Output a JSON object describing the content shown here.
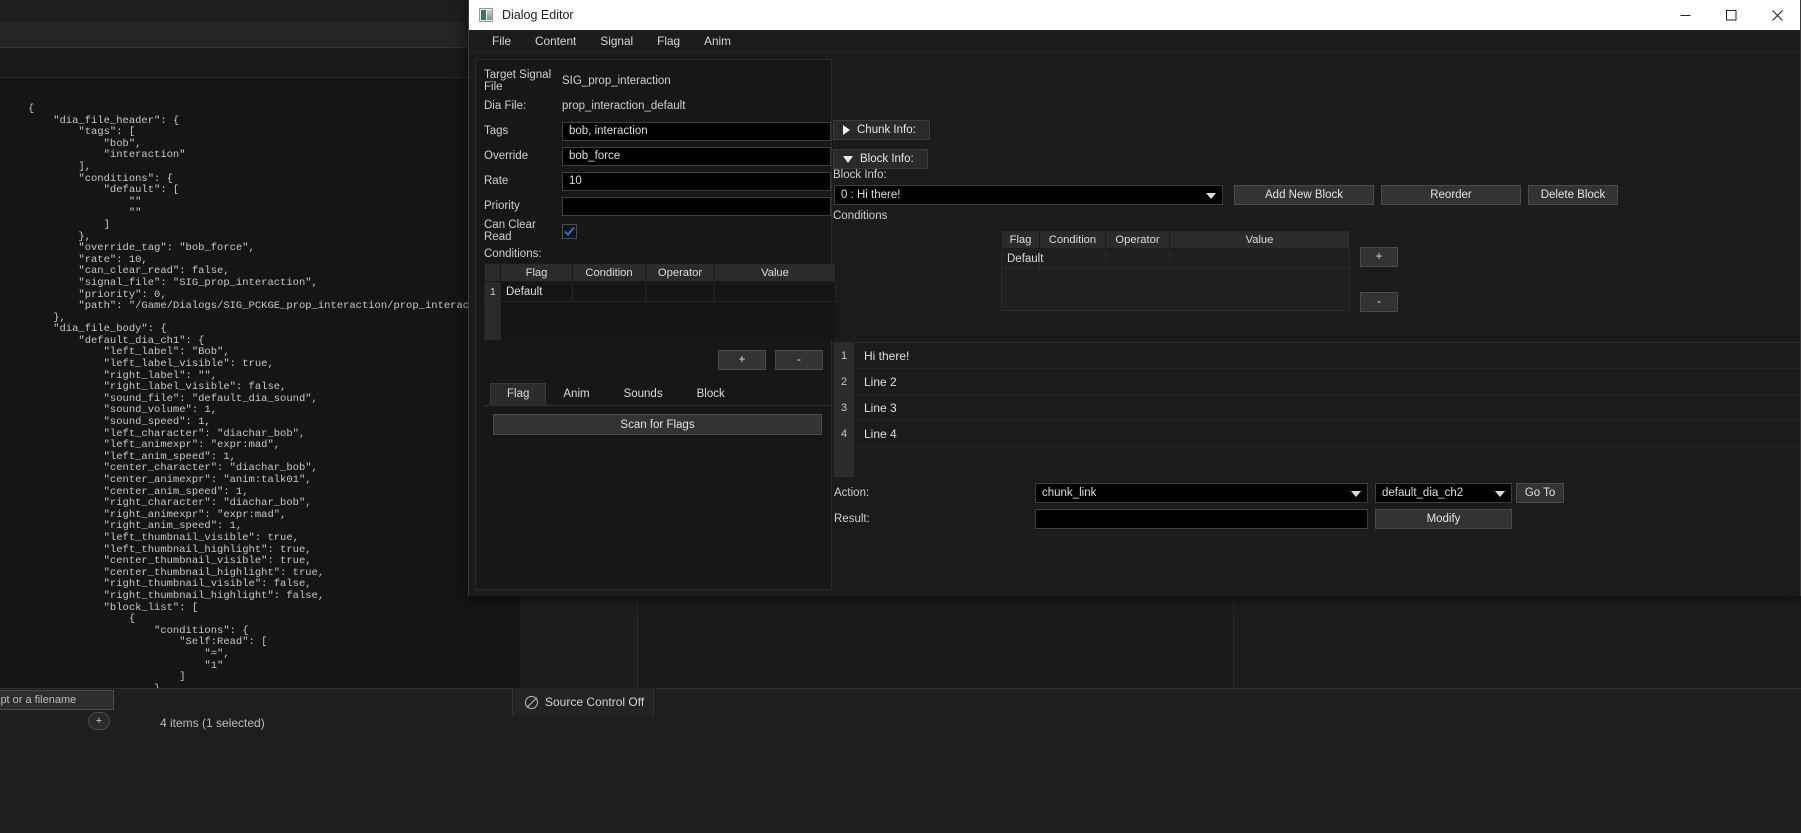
{
  "window": {
    "title": "Dialog Editor",
    "icon": "app-icon",
    "controls": {
      "minimize": "minimize-icon",
      "maximize": "maximize-icon",
      "close": "close-icon"
    }
  },
  "menubar": {
    "items": [
      {
        "label": "File"
      },
      {
        "label": "Content"
      },
      {
        "label": "Signal"
      },
      {
        "label": "Flag"
      },
      {
        "label": "Anim"
      }
    ]
  },
  "left_panel": {
    "target_signal_file": {
      "label": "Target Signal File",
      "value": "SIG_prop_interaction"
    },
    "dia_file": {
      "label": "Dia File:",
      "value": "prop_interaction_default"
    },
    "tags": {
      "label": "Tags",
      "value": "bob, interaction",
      "placeholder": ""
    },
    "override": {
      "label": "Override",
      "value": "bob_force",
      "placeholder": ""
    },
    "rate": {
      "label": "Rate",
      "value": "10",
      "placeholder": ""
    },
    "priority": {
      "label": "Priority",
      "value": "",
      "placeholder": ""
    },
    "can_clear_read": {
      "label": "Can Clear Read",
      "checked": true
    },
    "conditions": {
      "label": "Conditions:",
      "columns": [
        "",
        "Flag",
        "Condition",
        "Operator",
        "Value"
      ],
      "rows": [
        {
          "index": "1",
          "flag": "Default",
          "condition": "",
          "operator": "",
          "value": ""
        }
      ],
      "add_label": "+",
      "remove_label": "-"
    },
    "tabs": [
      {
        "label": "Flag",
        "active": true
      },
      {
        "label": "Anim",
        "active": false
      },
      {
        "label": "Sounds",
        "active": false
      },
      {
        "label": "Block",
        "active": false
      }
    ],
    "scan_for_flags": "Scan for Flags"
  },
  "right_panel": {
    "chunk_info": {
      "label": "Chunk Info:",
      "expanded": false,
      "icon": "chevron-right-icon"
    },
    "block_info_toggle": {
      "label": "Block Info:",
      "expanded": true,
      "icon": "chevron-down-icon"
    },
    "block_info_label": "Block Info:",
    "block_select": {
      "value": "0 : Hi there!",
      "options": [
        "0 : Hi there!"
      ]
    },
    "add_new_block": "Add New Block",
    "reorder": "Reorder",
    "delete_block": "Delete Block",
    "conditions_label": "Conditions",
    "conditions_table": {
      "columns": [
        "Flag",
        "Condition",
        "Operator",
        "Value"
      ],
      "rows": [
        {
          "flag": "Default",
          "condition": "",
          "operator": "",
          "value": ""
        }
      ]
    },
    "add_condition": "+",
    "remove_condition": "-",
    "lines": [
      {
        "num": "1",
        "text": "Hi there!"
      },
      {
        "num": "2",
        "text": "Line 2"
      },
      {
        "num": "3",
        "text": "Line 3"
      },
      {
        "num": "4",
        "text": "Line 4"
      }
    ],
    "action": {
      "label": "Action:",
      "value": "chunk_link",
      "options": [
        "chunk_link"
      ],
      "target_value": "default_dia_ch2",
      "target_options": [
        "default_dia_ch2"
      ],
      "goto_label": "Go To"
    },
    "result": {
      "label": "Result:",
      "value": "",
      "placeholder": "",
      "modify_label": "Modify"
    }
  },
  "background": {
    "code": "{\n    \"dia_file_header\": {\n        \"tags\": [\n            \"bob\",\n            \"interaction\"\n        ],\n        \"conditions\": {\n            \"default\": [\n                \"\"\n                \"\"\n            ]\n        },\n        \"override_tag\": \"bob_force\",\n        \"rate\": 10,\n        \"can_clear_read\": false,\n        \"signal_file\": \"SIG_prop_interaction\",\n        \"priority\": 0,\n        \"path\": \"/Game/Dialogs/SIG_PCKGE_prop_interaction/prop_interaction_default.prop_interaction_\n    },\n    \"dia_file_body\": {\n        \"default_dia_ch1\": {\n            \"left_label\": \"Bob\",\n            \"left_label_visible\": true,\n            \"right_label\": \"\",\n            \"right_label_visible\": false,\n            \"sound_file\": \"default_dia_sound\",\n            \"sound_volume\": 1,\n            \"sound_speed\": 1,\n            \"left_character\": \"diachar_bob\",\n            \"left_animexpr\": \"expr:mad\",\n            \"left_anim_speed\": 1,\n            \"center_character\": \"diachar_bob\",\n            \"center_animexpr\": \"anim:talk01\",\n            \"center_anim_speed\": 1,\n            \"right_character\": \"diachar_bob\",\n            \"right_animexpr\": \"expr:mad\",\n            \"right_anim_speed\": 1,\n            \"left_thumbnail_visible\": true,\n            \"left_thumbnail_highlight\": true,\n            \"center_thumbnail_visible\": true,\n            \"center_thumbnail_highlight\": true,\n            \"right_thumbnail_visible\": false,\n            \"right_thumbnail_highlight\": false,\n            \"block_list\": [\n                {\n                    \"conditions\": {\n                        \"Self:Read\": [\n                            \"=\",\n                            \"1\"\n                        ]\n                    },",
    "filename_field": {
      "value": "ipt or a filename",
      "placeholder": ""
    },
    "source_control": {
      "label": "Source Control Off",
      "icon": "source-control-off-icon"
    },
    "status": "4 items (1 selected)",
    "add_button": "+"
  }
}
